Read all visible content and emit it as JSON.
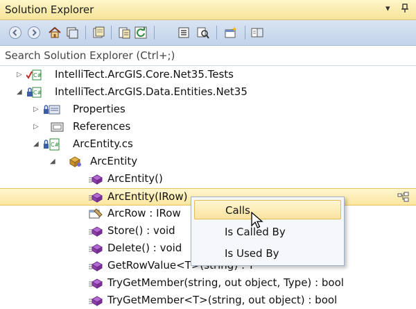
{
  "window": {
    "title": "Solution Explorer",
    "pin_glyph": "▾",
    "pushpin_glyph": "⊣"
  },
  "toolbar": {
    "buttons": [
      "back-icon",
      "forward-icon",
      "home-icon",
      "switch-views-icon",
      "pending-changes-icon",
      "properties-icon",
      "refresh-icon",
      "collapse-all-icon",
      "show-all-files-icon",
      "new-solution-explorer-icon",
      "preview-icon"
    ]
  },
  "search": {
    "placeholder": "Search Solution Explorer (Ctrl+;)"
  },
  "tree": {
    "items": [
      {
        "label": "IntelliTect.ArcGIS.Core.Net35.Tests",
        "arrow": "▷"
      },
      {
        "label": "IntelliTect.ArcGIS.Data.Entities.Net35",
        "arrow": "◢"
      },
      {
        "label": "Properties",
        "arrow": "▷"
      },
      {
        "label": "References",
        "arrow": "▷"
      },
      {
        "label": "ArcEntity.cs",
        "arrow": "◢"
      },
      {
        "label": "ArcEntity",
        "arrow": "◢"
      },
      {
        "label": "ArcEntity()",
        "arrow": ""
      },
      {
        "label": "ArcEntity(IRow)",
        "arrow": ""
      },
      {
        "label": "ArcRow : IRow",
        "arrow": ""
      },
      {
        "label": "Store() : void",
        "arrow": ""
      },
      {
        "label": "Delete() : void",
        "arrow": ""
      },
      {
        "label": "GetRowValue<T>(string) : T",
        "arrow": ""
      },
      {
        "label": "TryGetMember(string, out object, Type) : bool",
        "arrow": ""
      },
      {
        "label": "TryGetMember<T>(string, out object) : bool",
        "arrow": ""
      }
    ]
  },
  "context_menu": {
    "items": [
      {
        "label": "Calls"
      },
      {
        "label": "Is Called By"
      },
      {
        "label": "Is Used By"
      }
    ]
  },
  "colors": {
    "title_bar": "#f7e49a",
    "toolbar": "#c3d3ea",
    "selection": "#fbe6a0",
    "method_icon": "#8e3fa8",
    "class_icon": "#b9892d",
    "csharp_icon": "#2a8a3a"
  }
}
